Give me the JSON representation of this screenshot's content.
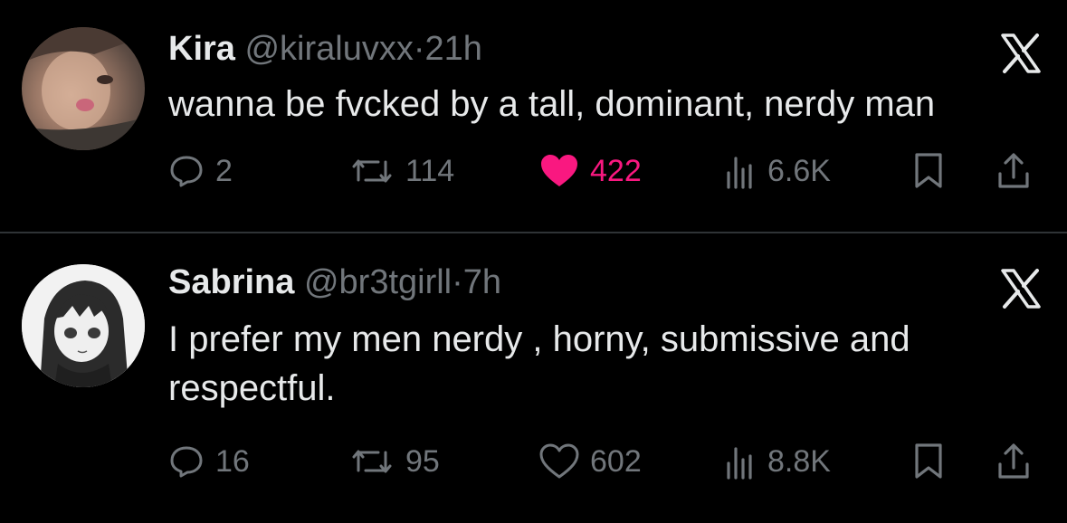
{
  "tweets": [
    {
      "name": "Kira",
      "handle": "@kiraluvxx",
      "dot": "·",
      "time": "21h",
      "text": "wanna be fvcked by a tall, dominant, nerdy man",
      "replies": "2",
      "retweets": "114",
      "likes": "422",
      "liked": true,
      "views": "6.6K"
    },
    {
      "name": "Sabrina",
      "handle": "@br3tgirll",
      "dot": "·",
      "time": "7h",
      "text": "I prefer my men nerdy , horny, submissive and respectful.",
      "replies": "16",
      "retweets": "95",
      "likes": "602",
      "liked": false,
      "views": "8.8K"
    }
  ],
  "colors": {
    "background": "#000000",
    "text": "#e7e9ea",
    "secondary": "#71767b",
    "like_active": "#f91880",
    "divider": "#2f3336"
  },
  "icons": [
    "reply-icon",
    "retweet-icon",
    "like-icon",
    "views-icon",
    "bookmark-icon",
    "share-icon",
    "x-logo-icon"
  ]
}
